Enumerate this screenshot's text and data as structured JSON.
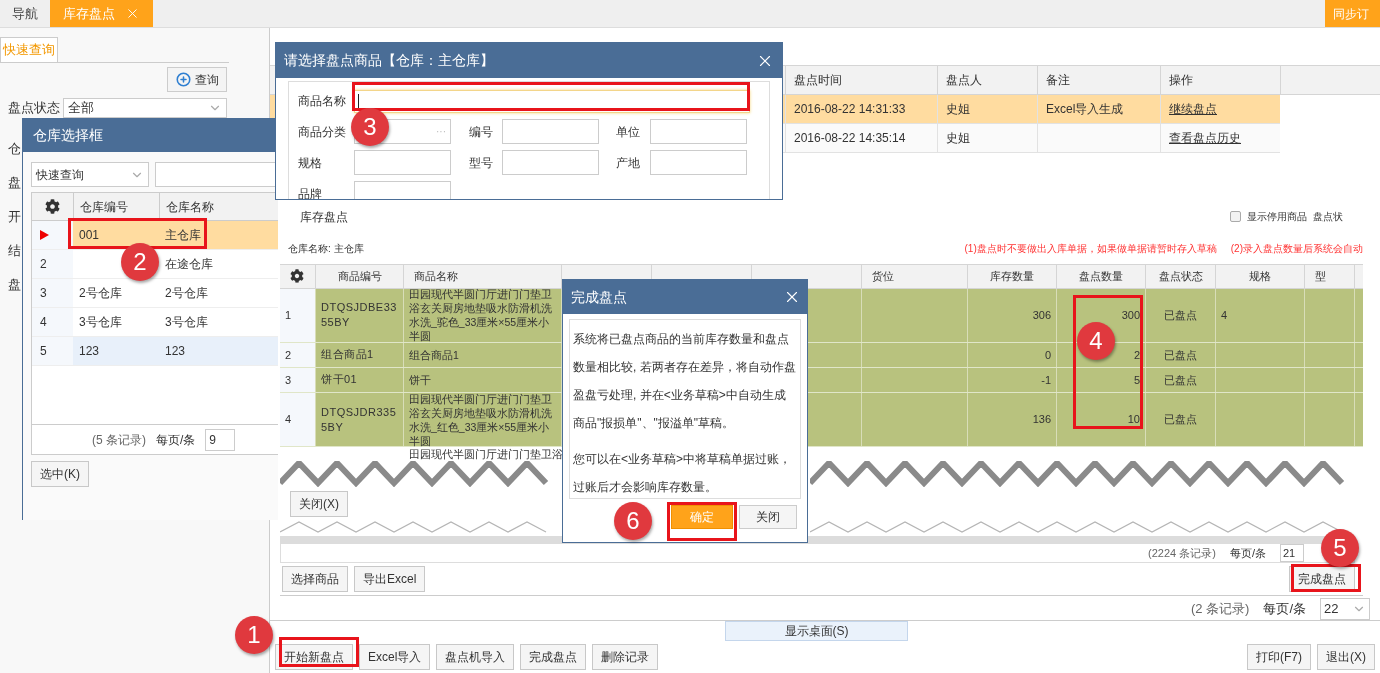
{
  "tabs": [
    {
      "label": "导航",
      "selected": false,
      "closable": false
    },
    {
      "label": "库存盘点",
      "selected": true,
      "closable": true
    }
  ],
  "sync_button": "同步订",
  "query_panel": {
    "tab": "快速查询",
    "query_button": "查询",
    "filters": [
      {
        "label": "盘点状态",
        "value": "全部"
      },
      {
        "label": "仓"
      },
      {
        "label": "盘"
      },
      {
        "label": "开"
      },
      {
        "label": "结"
      },
      {
        "label": "盘"
      }
    ]
  },
  "records": {
    "columns": [
      "盘点时间",
      "盘点人",
      "备注",
      "操作"
    ],
    "rows": [
      {
        "time": "2016-08-22 14:31:33",
        "person": "史姐",
        "note": "Excel导入生成",
        "action": "继续盘点",
        "selected": true
      },
      {
        "time": "2016-08-22 14:35:14",
        "person": "史姐",
        "action": "查看盘点历史",
        "selected": false
      }
    ],
    "count": "(2 条记录)",
    "per_page_label": "每页/条",
    "per_page": "22"
  },
  "show_desktop": "显示桌面(S)",
  "toolbar_left": [
    "开始新盘点",
    "Excel导入",
    "盘点机导入",
    "完成盘点",
    "删除记录"
  ],
  "toolbar_right": [
    "打印(F7)",
    "退出(X)"
  ],
  "warehouse_dialog": {
    "title": "仓库选择框",
    "search_mode": "快速查询",
    "columns": [
      "仓库编号",
      "仓库名称"
    ],
    "rows": [
      {
        "code": "001",
        "name": "主仓库",
        "selected": true,
        "hovered": false
      },
      {
        "num": "2",
        "name": "在途仓库",
        "selected": false,
        "hovered": false
      },
      {
        "num": "3",
        "code": "2号仓库",
        "name": "2号仓库",
        "selected": false,
        "hovered": false
      },
      {
        "num": "4",
        "code": "3号仓库",
        "name": "3号仓库",
        "selected": false,
        "hovered": false
      },
      {
        "num": "5",
        "code": "123",
        "name": "123",
        "selected": false,
        "hovered": true
      }
    ],
    "count": "(5 条记录)",
    "per_page_label": "每页/条",
    "per_page": "9",
    "select_button": "选中(K)"
  },
  "product_dialog": {
    "title": "请选择盘点商品【仓库：主仓库】",
    "fields": [
      {
        "label": "商品名称",
        "focused": true
      },
      {
        "label": "商品分类",
        "picker": "···"
      },
      {
        "label": "编号"
      },
      {
        "label": "单位"
      },
      {
        "label": "规格"
      },
      {
        "label": "型号"
      },
      {
        "label": "产地"
      },
      {
        "label": "品牌"
      }
    ]
  },
  "inventory_panel": {
    "title": "库存盘点",
    "show_disabled": {
      "label": "显示停用商品",
      "checked": false
    },
    "status_label": "盘点状",
    "warehouse": "仓库名称: 主仓库",
    "notes": [
      "(1)盘点时不要做出入库单据，如果做单据请暂时存入草稿",
      "(2)录入盘点数量后系统会自动"
    ],
    "headers": {
      "code": "商品编号",
      "name": "商品名称",
      "location": "货位",
      "stock": "库存数量",
      "counted": "盘点数量",
      "status": "盘点状态",
      "spec": "规格",
      "model": "型"
    },
    "rows": [
      {
        "num": "1",
        "code": "DTQSJDBE3355BY",
        "name": "田园现代半圆门厅进门门垫卫浴玄关厨房地垫吸水防滑机洗水洗_驼色_33厘米×55厘米小半圆",
        "stock": "306",
        "counted": "300",
        "status": "已盘点",
        "spec": "4"
      },
      {
        "num": "2",
        "code": "组合商品1",
        "name": "组合商品1",
        "stock": "0",
        "counted": "2",
        "status": "已盘点"
      },
      {
        "num": "3",
        "code": "饼干01",
        "name": "饼干",
        "stock": "-1",
        "counted": "5",
        "status": "已盘点"
      },
      {
        "num": "4",
        "code": "DTQSJDR3355BY",
        "name": "田园现代半圆门厅进门门垫卫浴玄关厨房地垫吸水防滑机洗水洗_红色_33厘米×55厘米小半圆",
        "stock": "136",
        "counted": "10",
        "status": "已盘点"
      }
    ],
    "cut_row_name": "田园现代半圆门厅进门门垫卫浴",
    "close_button": "关闭(X)",
    "count": "(2224 条记录)",
    "per_page_label": "每页/条",
    "per_page": "21",
    "finish_button": "完成盘点",
    "buttons": [
      "选择商品",
      "导出Excel"
    ]
  },
  "finish_dialog": {
    "title": "完成盘点",
    "paragraphs": [
      "系统将已盘点商品的当前库存数量和盘点数量相比较, 若两者存在差异，将自动作盘盈盘亏处理, 并在<业务草稿>中自动生成商品\"报损单\"、\"报溢单\"草稿。",
      "您可以在<业务草稿>中将草稿单据过账，过账后才会影响库存数量。"
    ],
    "buttons": [
      {
        "label": "确定",
        "kind": "primary"
      },
      {
        "label": "关闭",
        "kind": "secondary"
      }
    ]
  },
  "annotations": [
    {
      "number": "1"
    },
    {
      "number": "2"
    },
    {
      "number": "3"
    },
    {
      "number": "4"
    },
    {
      "number": "5"
    },
    {
      "number": "6"
    }
  ]
}
